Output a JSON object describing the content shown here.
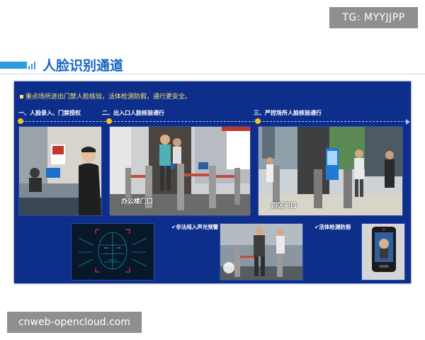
{
  "badge": "TG: MYYJJPP",
  "title": "人脸识别通道",
  "slide": {
    "headline": "重点场所进出门禁人脸核验，活体检测防假，通行更安全。",
    "steps": [
      {
        "label": "一、人脸录入、门禁授权"
      },
      {
        "label": "二、出入口人脸核验通行"
      },
      {
        "label": "三、严控场所人脸核验通行"
      }
    ],
    "captions": {
      "office_gate": "办公楼门口",
      "park_gate": "园区门口"
    },
    "features": {
      "alarm": "✔非法闯入声光预警",
      "liveness": "✔活体检测防假"
    }
  },
  "watermark": "cnweb-opencloud.com",
  "colors": {
    "accent": "#2f9be0",
    "title": "#1565c0",
    "slide_bg": "#0e2e8c",
    "highlight": "#ffe46b",
    "dot": "#f7c21a"
  }
}
